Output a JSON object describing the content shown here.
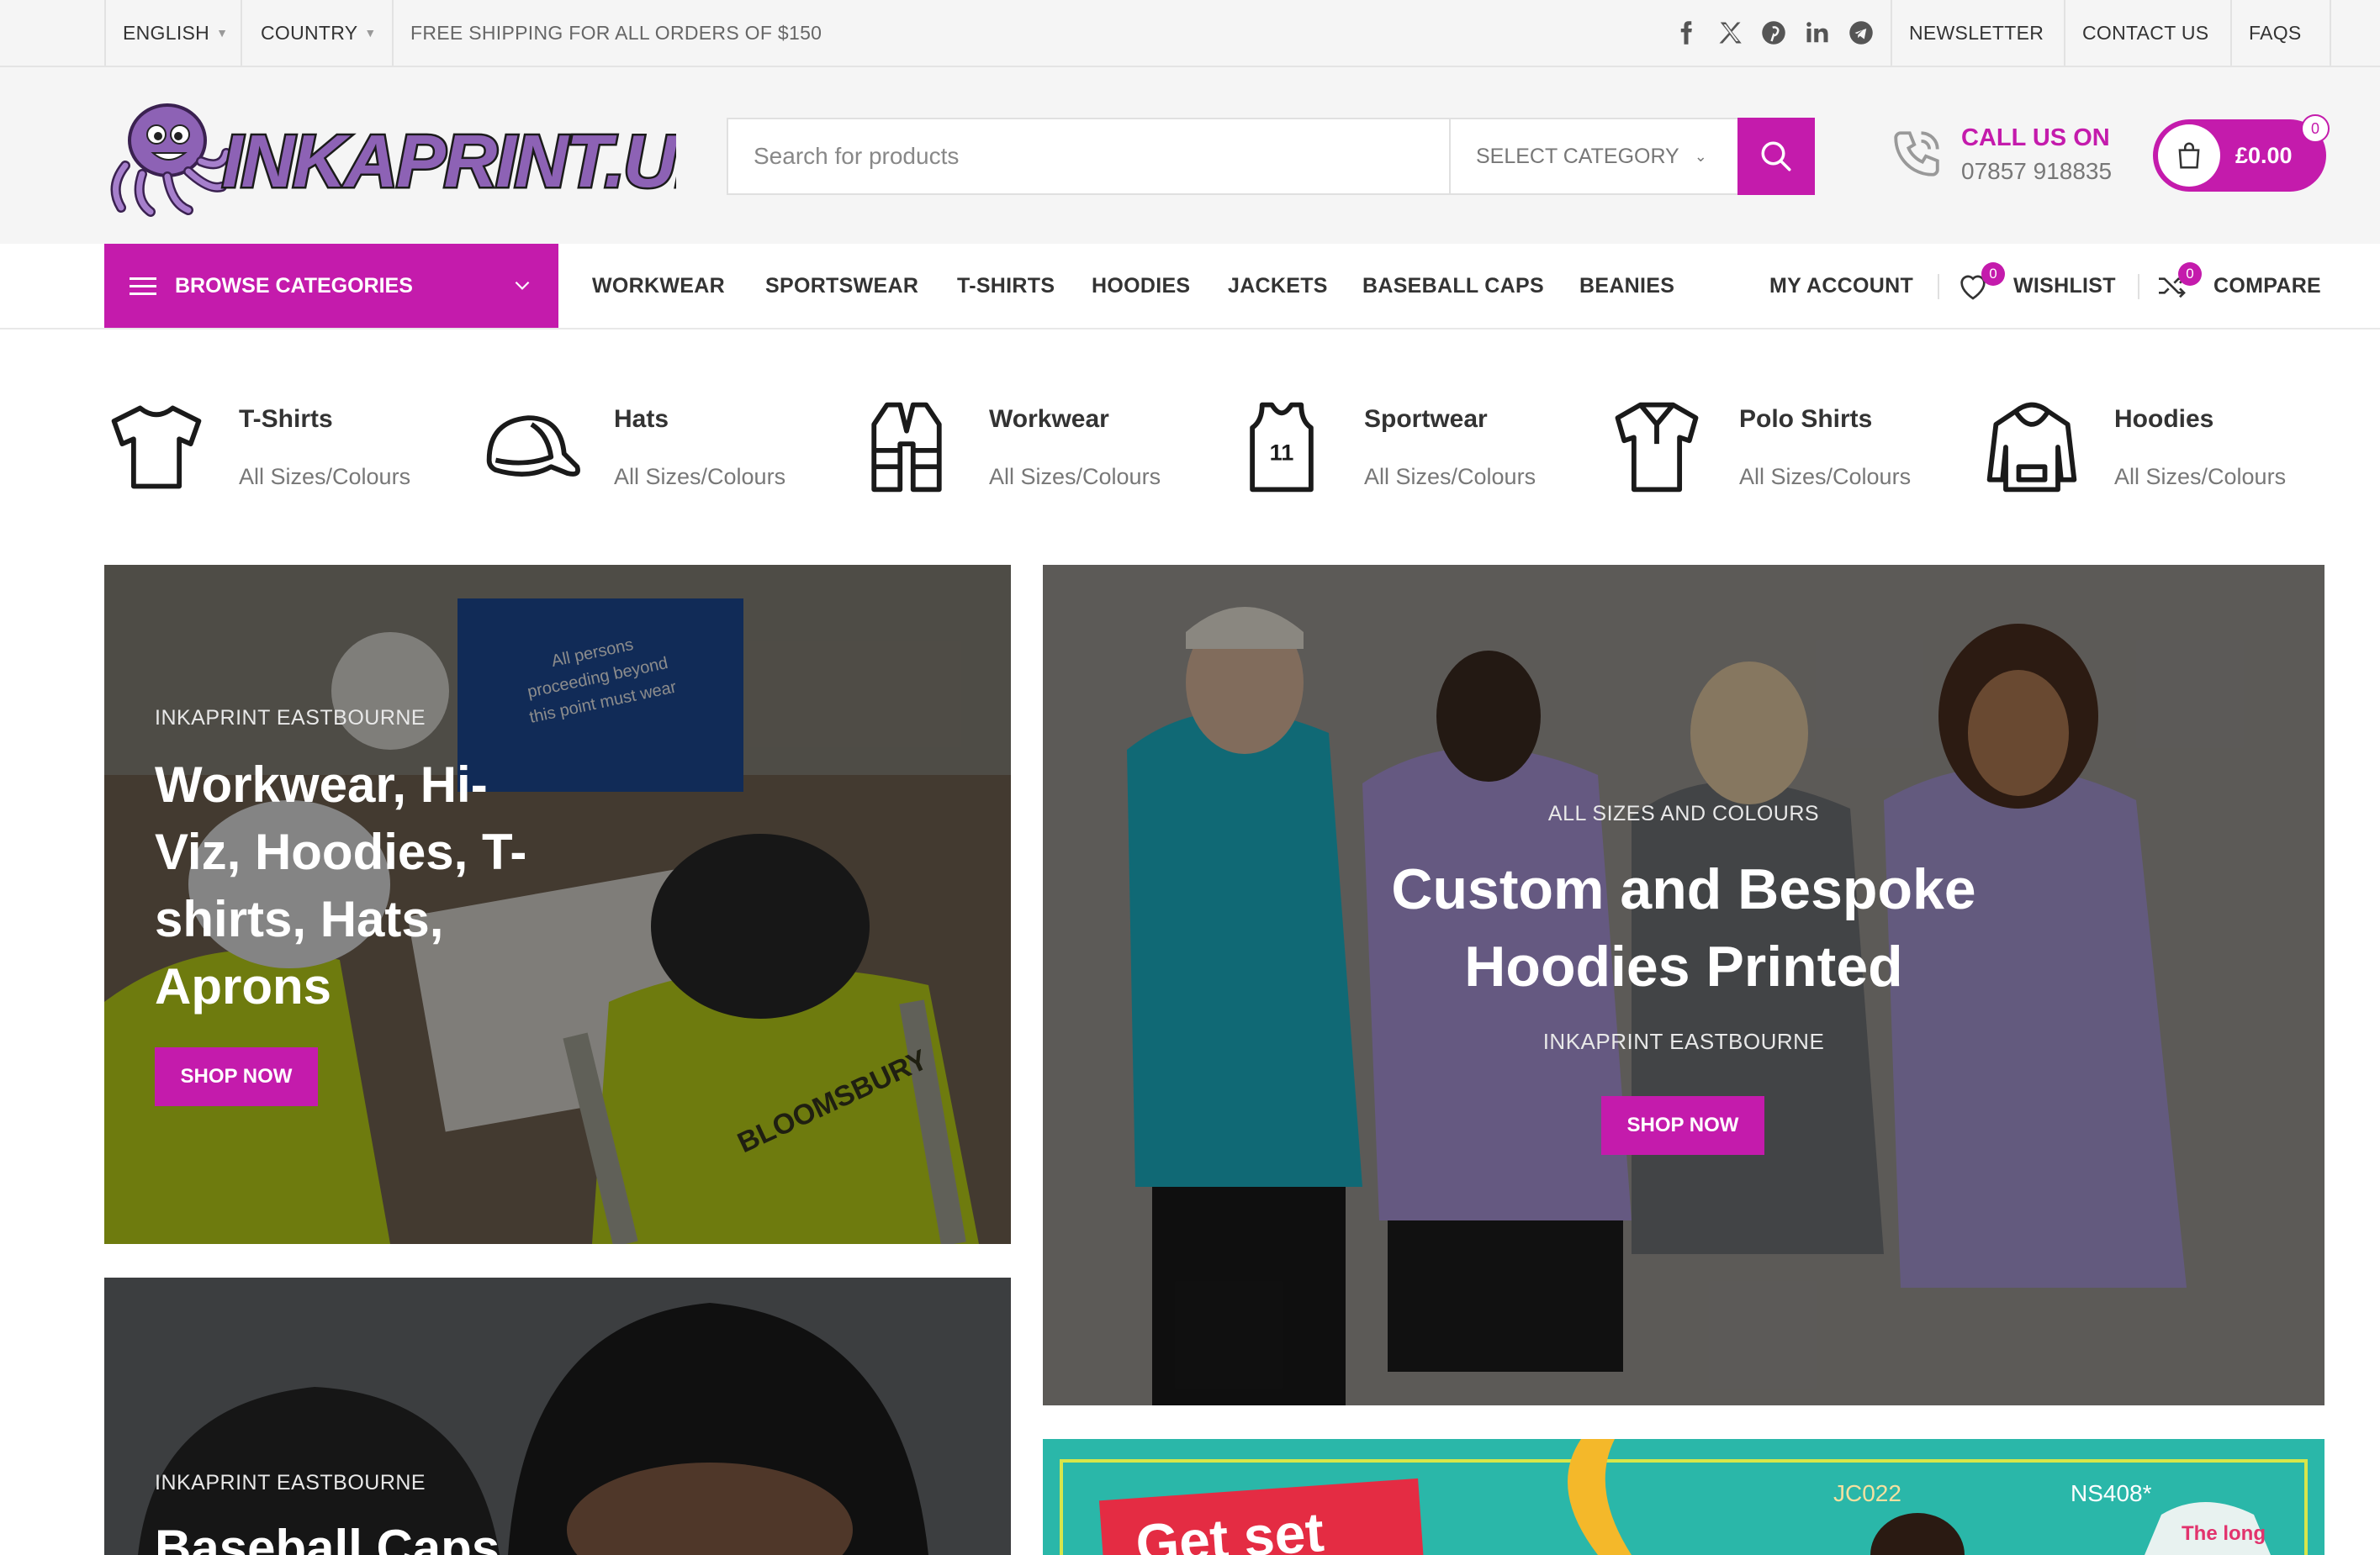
{
  "topbar": {
    "language": "ENGLISH",
    "country": "COUNTRY",
    "shipping": "FREE SHIPPING FOR ALL ORDERS OF $150",
    "links": [
      "NEWSLETTER",
      "CONTACT US",
      "FAQS"
    ]
  },
  "header": {
    "search_placeholder": "Search for products",
    "select_category": "SELECT CATEGORY",
    "call_title": "CALL US ON",
    "call_number": "07857 918835",
    "cart_total": "£0.00",
    "cart_count": "0"
  },
  "nav": {
    "browse": "BROWSE CATEGORIES",
    "links": [
      "WORKWEAR",
      "SPORTSWEAR",
      "T-SHIRTS",
      "HOODIES",
      "JACKETS",
      "BASEBALL CAPS",
      "BEANIES"
    ],
    "my_account": "MY ACCOUNT",
    "wishlist": "WISHLIST",
    "wishlist_count": "0",
    "compare": "COMPARE",
    "compare_count": "0"
  },
  "categories": [
    {
      "title": "T-Shirts",
      "subtitle": "All Sizes/Colours",
      "icon": "tshirt-icon"
    },
    {
      "title": "Hats",
      "subtitle": "All Sizes/Colours",
      "icon": "cap-icon"
    },
    {
      "title": "Workwear",
      "subtitle": "All Sizes/Colours",
      "icon": "vest-icon"
    },
    {
      "title": "Sportwear",
      "subtitle": "All Sizes/Colours",
      "icon": "jersey-icon"
    },
    {
      "title": "Polo Shirts",
      "subtitle": "All Sizes/Colours",
      "icon": "polo-icon"
    },
    {
      "title": "Hoodies",
      "subtitle": "All Sizes/Colours",
      "icon": "hoodie-icon"
    }
  ],
  "banners": {
    "workwear": {
      "subtitle": "INKAPRINT EASTBOURNE",
      "title_lines": [
        "Workwear, Hi-",
        "Viz, Hoodies, T-",
        "shirts, Hats,",
        "Aprons"
      ],
      "button": "SHOP NOW",
      "sign_text": "All persons proceeding beyond this point must wear an approved safety helmet and high visibility jacket",
      "vest_text": "BLOOMSBURY"
    },
    "hoodies": {
      "subtitle": "ALL SIZES AND COLOURS",
      "title_lines": [
        "Custom and Bespoke",
        "Hoodies Printed"
      ],
      "subtitle2": "INKAPRINT EASTBOURNE",
      "button": "SHOP NOW"
    },
    "caps": {
      "subtitle": "INKAPRINT EASTBOURNE",
      "title": "Baseball Caps"
    },
    "promo": {
      "headline": "Get set",
      "codes": [
        "JC022",
        "NS408*"
      ],
      "hoodie_text": "The long"
    }
  },
  "logo_text": "INKAPRINT.UK",
  "colors": {
    "accent": "#c41bac",
    "topbar_bg": "#f5f5f5"
  }
}
